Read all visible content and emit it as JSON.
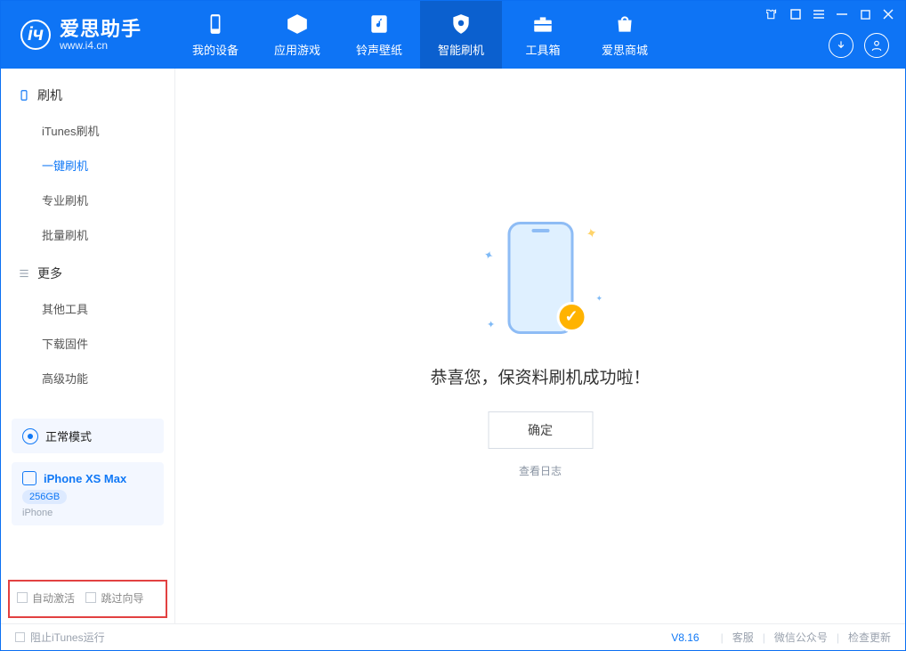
{
  "app": {
    "name": "爱思助手",
    "domain": "www.i4.cn"
  },
  "nav": {
    "items": [
      {
        "label": "我的设备"
      },
      {
        "label": "应用游戏"
      },
      {
        "label": "铃声壁纸"
      },
      {
        "label": "智能刷机"
      },
      {
        "label": "工具箱"
      },
      {
        "label": "爱思商城"
      }
    ]
  },
  "sidebar": {
    "group1_title": "刷机",
    "items1": [
      {
        "label": "iTunes刷机"
      },
      {
        "label": "一键刷机"
      },
      {
        "label": "专业刷机"
      },
      {
        "label": "批量刷机"
      }
    ],
    "group2_title": "更多",
    "items2": [
      {
        "label": "其他工具"
      },
      {
        "label": "下载固件"
      },
      {
        "label": "高级功能"
      }
    ]
  },
  "device": {
    "mode": "正常模式",
    "name": "iPhone XS Max",
    "storage": "256GB",
    "type": "iPhone"
  },
  "options": {
    "auto_activate": "自动激活",
    "skip_guide": "跳过向导"
  },
  "main": {
    "message": "恭喜您，保资料刷机成功啦！",
    "ok": "确定",
    "view_log": "查看日志"
  },
  "footer": {
    "block_itunes": "阻止iTunes运行",
    "version": "V8.16",
    "links": [
      "客服",
      "微信公众号",
      "检查更新"
    ]
  }
}
